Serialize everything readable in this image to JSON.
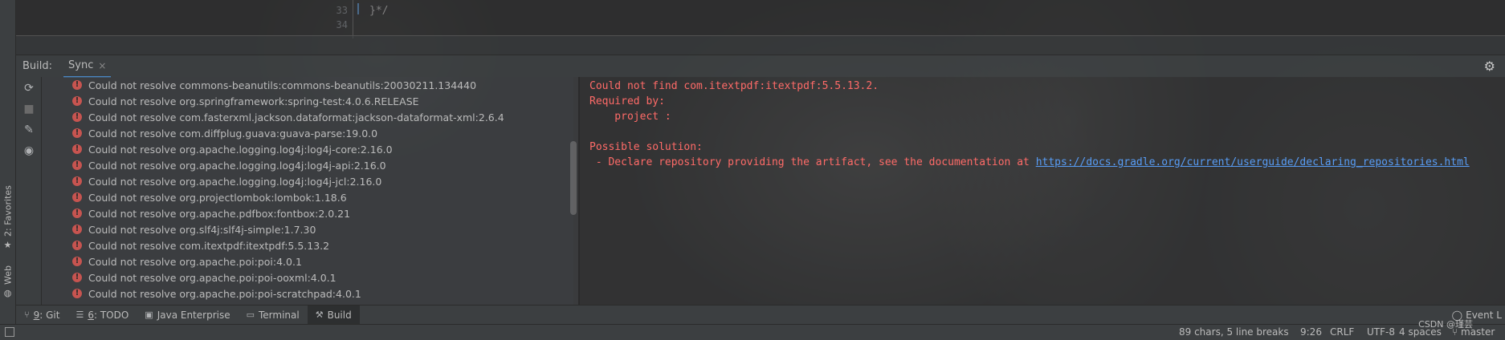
{
  "editor": {
    "line_numbers": [
      "33",
      "34"
    ],
    "code_line": "}*/"
  },
  "side_tabs": {
    "favorites": "2: Favorites",
    "web": "Web"
  },
  "build_panel": {
    "title": "Build:",
    "tab": "Sync",
    "tab_close": "×"
  },
  "errors": [
    "Could not resolve commons-beanutils:commons-beanutils:20030211.134440",
    "Could not resolve org.springframework:spring-test:4.0.6.RELEASE",
    "Could not resolve com.fasterxml.jackson.dataformat:jackson-dataformat-xml:2.6.4",
    "Could not resolve com.diffplug.guava:guava-parse:19.0.0",
    "Could not resolve org.apache.logging.log4j:log4j-core:2.16.0",
    "Could not resolve org.apache.logging.log4j:log4j-api:2.16.0",
    "Could not resolve org.apache.logging.log4j:log4j-jcl:2.16.0",
    "Could not resolve org.projectlombok:lombok:1.18.6",
    "Could not resolve org.apache.pdfbox:fontbox:2.0.21",
    "Could not resolve org.slf4j:slf4j-simple:1.7.30",
    "Could not resolve com.itextpdf:itextpdf:5.5.13.2",
    "Could not resolve org.apache.poi:poi:4.0.1",
    "Could not resolve org.apache.poi:poi-ooxml:4.0.1",
    "Could not resolve org.apache.poi:poi-scratchpad:4.0.1"
  ],
  "console": {
    "line1": "Could not find com.itextpdf:itextpdf:5.5.13.2.",
    "line2": "Required by:",
    "line3": "    project :",
    "line4": "Possible solution:",
    "line5": " - Declare repository providing the artifact, see the documentation at ",
    "link": "https://docs.gradle.org/current/userguide/declaring_repositories.html"
  },
  "bottom_tabs": [
    {
      "num": "9",
      "label": ": Git",
      "icon": "git-branch-icon"
    },
    {
      "num": "6",
      "label": ": TODO",
      "icon": "list-icon"
    },
    {
      "num": "",
      "label": "Java Enterprise",
      "icon": "java-enterprise-icon"
    },
    {
      "num": "",
      "label": "Terminal",
      "icon": "terminal-icon"
    },
    {
      "num": "",
      "label": "Build",
      "icon": "hammer-icon"
    }
  ],
  "event_log": "Event L",
  "status": {
    "chars": "89 chars, 5 line breaks",
    "position": "9:26",
    "line_sep": "CRLF",
    "encoding": "UTF-8",
    "indent": "4 spaces",
    "branch": "master"
  },
  "watermark": "CSDN @瑾芸"
}
